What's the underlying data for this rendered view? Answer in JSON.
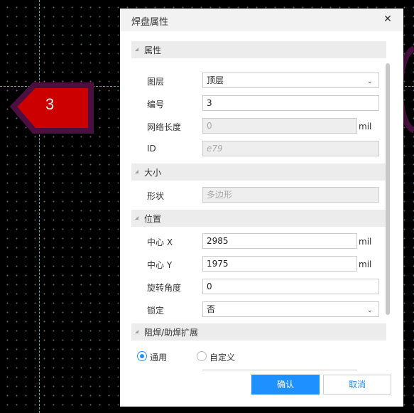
{
  "canvas": {
    "pad_number": "3",
    "pad_color": "#cc0000",
    "pad_outline_color": "#4a1040",
    "guide_color": "#3fb9b9"
  },
  "dialog": {
    "title": "焊盘属性",
    "close_icon": "close-icon",
    "sections": {
      "attributes": "属性",
      "size": "大小",
      "position": "位置",
      "mask": "阻焊/助焊扩展"
    },
    "fields": {
      "layer": {
        "label": "图层",
        "value": "顶层"
      },
      "number": {
        "label": "编号",
        "value": "3"
      },
      "net_length": {
        "label": "网络长度",
        "value": "0",
        "unit": "mil"
      },
      "id": {
        "label": "ID",
        "value": "e79"
      },
      "shape": {
        "label": "形状",
        "value": "多边形"
      },
      "center_x": {
        "label": "中心 X",
        "value": "2985",
        "unit": "mil"
      },
      "center_y": {
        "label": "中心 Y",
        "value": "1975",
        "unit": "mil"
      },
      "rotation": {
        "label": "旋转角度",
        "value": "0"
      },
      "lock": {
        "label": "锁定",
        "value": "否"
      }
    },
    "mask_options": {
      "general": "通用",
      "custom": "自定义",
      "selected": "通用"
    },
    "buttons": {
      "confirm": "确认",
      "cancel": "取消"
    },
    "accent_color": "#1e90ff"
  }
}
